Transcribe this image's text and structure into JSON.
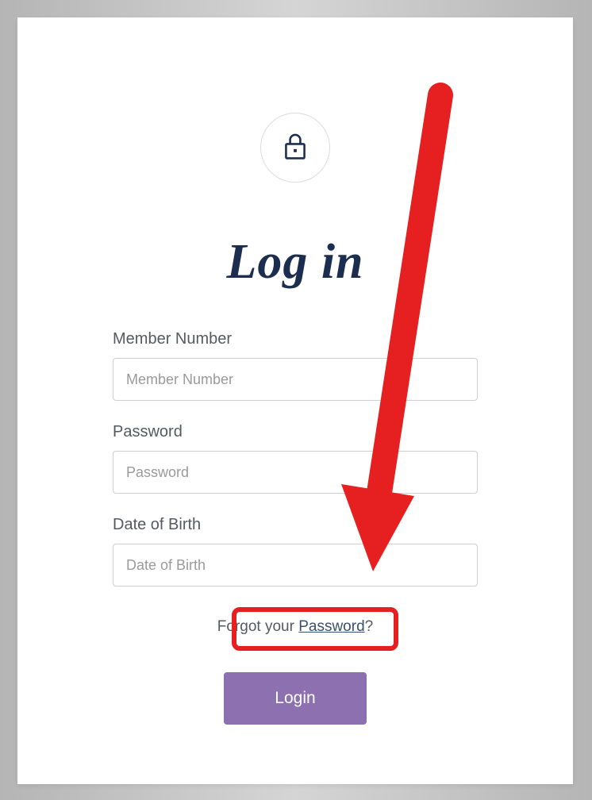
{
  "title": "Log in",
  "fields": {
    "member_number": {
      "label": "Member Number",
      "placeholder": "Member Number",
      "value": ""
    },
    "password": {
      "label": "Password",
      "placeholder": "Password",
      "value": ""
    },
    "dob": {
      "label": "Date of Birth",
      "placeholder": "Date of Birth",
      "value": ""
    }
  },
  "forgot": {
    "prefix": "Forgot your ",
    "link": "Password",
    "suffix": "?"
  },
  "login_button": "Login",
  "colors": {
    "brand_dark": "#1c2e4f",
    "button_bg": "#8c70b0",
    "annotation": "#e62020"
  }
}
